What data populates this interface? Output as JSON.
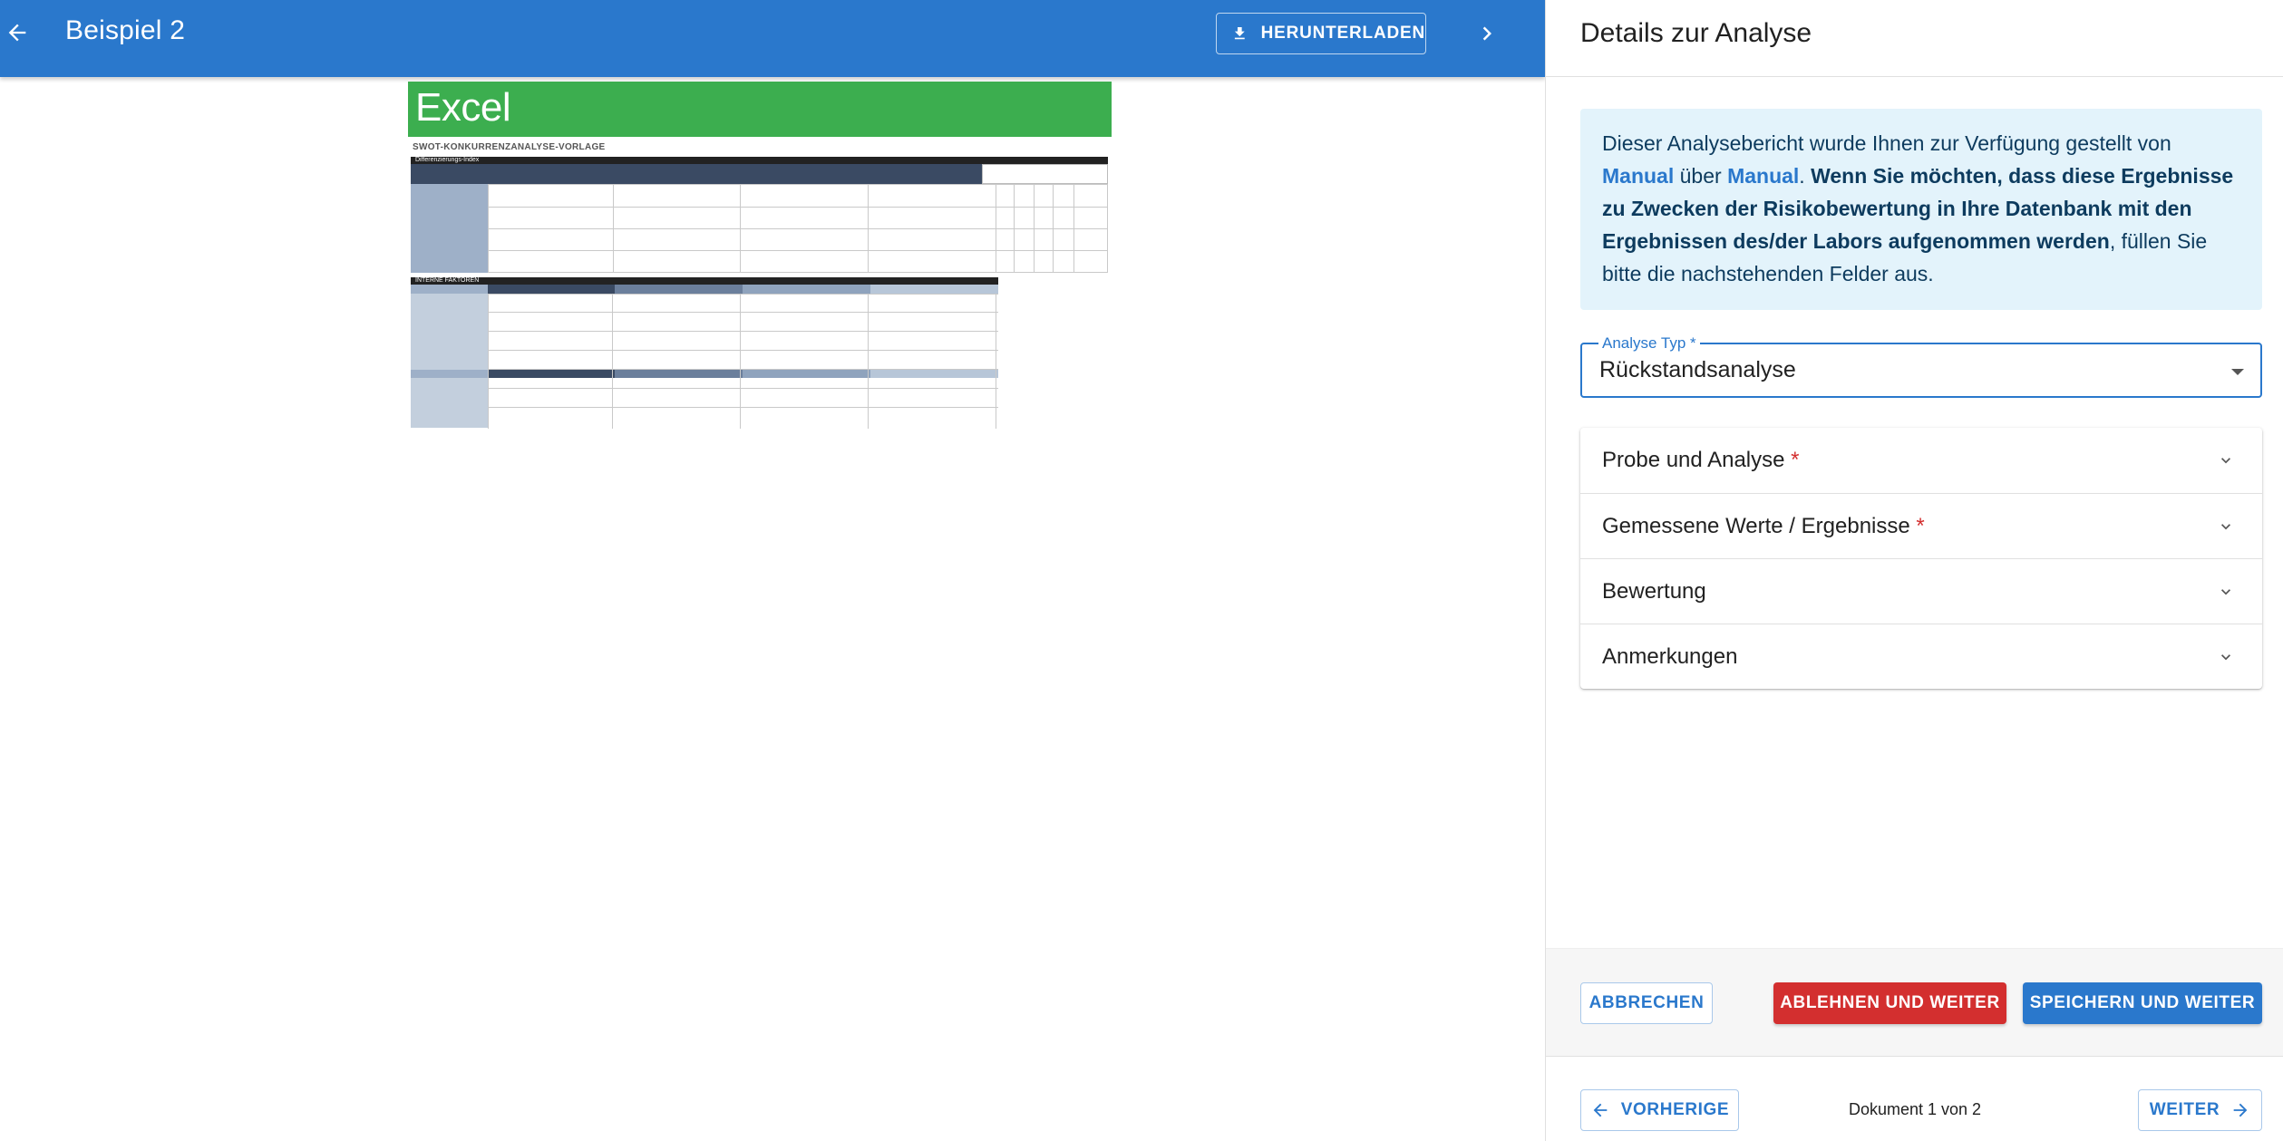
{
  "toolbar": {
    "title": "Beispiel 2",
    "download_label": "HERUNTERLADEN"
  },
  "preview": {
    "banner_text": "Excel",
    "sheet_title": "SWOT-KONKURRENZANALYSE-VORLAGE",
    "table1_header": "Differenzierungs-Index",
    "table2_header": "INTERNE FAKTOREN"
  },
  "panel": {
    "title": "Details zur Analyse",
    "info": {
      "prefix": "Dieser Analysebericht wurde Ihnen zur Verfügung gestellt von ",
      "link1": "Manual",
      "mid": " über ",
      "link2": "Manual",
      "dot": ". ",
      "bold": "Wenn Sie möchten, dass diese Ergebnisse zu Zwecken der Risikobewertung in Ihre Datenbank mit den Ergebnissen des/der Labors aufgenommen werden",
      "suffix": ", füllen Sie bitte die nachstehenden Felder aus."
    },
    "analysis_type": {
      "label": "Analyse Typ *",
      "value": "Rückstandsanalyse"
    },
    "sections": [
      {
        "label": "Probe und Analyse",
        "required": " *"
      },
      {
        "label": "Gemessene Werte / Ergebnisse",
        "required": " *"
      },
      {
        "label": "Bewertung",
        "required": ""
      },
      {
        "label": "Anmerkungen",
        "required": ""
      }
    ],
    "actions": {
      "cancel": "ABBRECHEN",
      "reject": "ABLEHNEN UND WEITER",
      "save": "SPEICHERN UND WEITER"
    },
    "pager": {
      "prev": "VORHERIGE",
      "count": "Dokument 1 von 2",
      "next": "WEITER"
    }
  },
  "colors": {
    "primary": "#2a78cc",
    "danger": "#d32f2f",
    "excel_green": "#3cae4f",
    "info_bg": "#e3f3fb"
  }
}
